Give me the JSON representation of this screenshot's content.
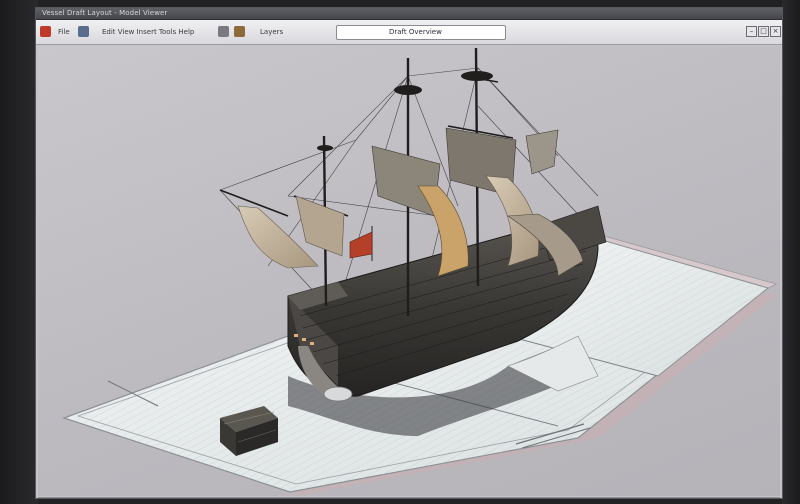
{
  "window": {
    "title": "Vessel Draft Layout - Model Viewer"
  },
  "toolbar": {
    "label_1": "File",
    "label_2": "Edit View Insert Tools Help",
    "label_3": "Layers",
    "label_4": "Draft Overview",
    "search_value": "Draft Overview"
  },
  "icons": {
    "app_icon": "app-logo-icon",
    "minimize": "minimize-icon",
    "maximize": "maximize-icon",
    "close": "close-icon"
  },
  "colors": {
    "hull": "#3a3835",
    "sail": "#c9b9a2",
    "flag_red": "#b5402a",
    "mat": "#e8ecec"
  }
}
